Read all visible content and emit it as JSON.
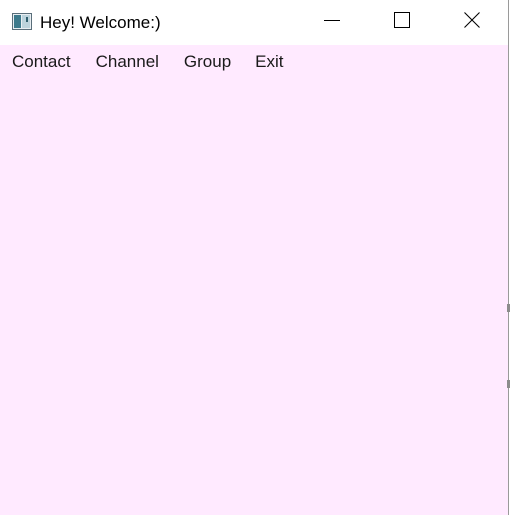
{
  "window": {
    "title": "Hey! Welcome:)",
    "icon": "app-window-icon",
    "controls": {
      "minimize_icon": "minimize-icon",
      "maximize_icon": "maximize-icon",
      "close_icon": "close-icon"
    }
  },
  "menubar": {
    "items": [
      {
        "label": "Contact"
      },
      {
        "label": "Channel"
      },
      {
        "label": "Group"
      },
      {
        "label": "Exit"
      }
    ]
  },
  "colors": {
    "titlebar_bg": "#ffffff",
    "client_bg": "#ffeaff",
    "text": "#000000"
  }
}
